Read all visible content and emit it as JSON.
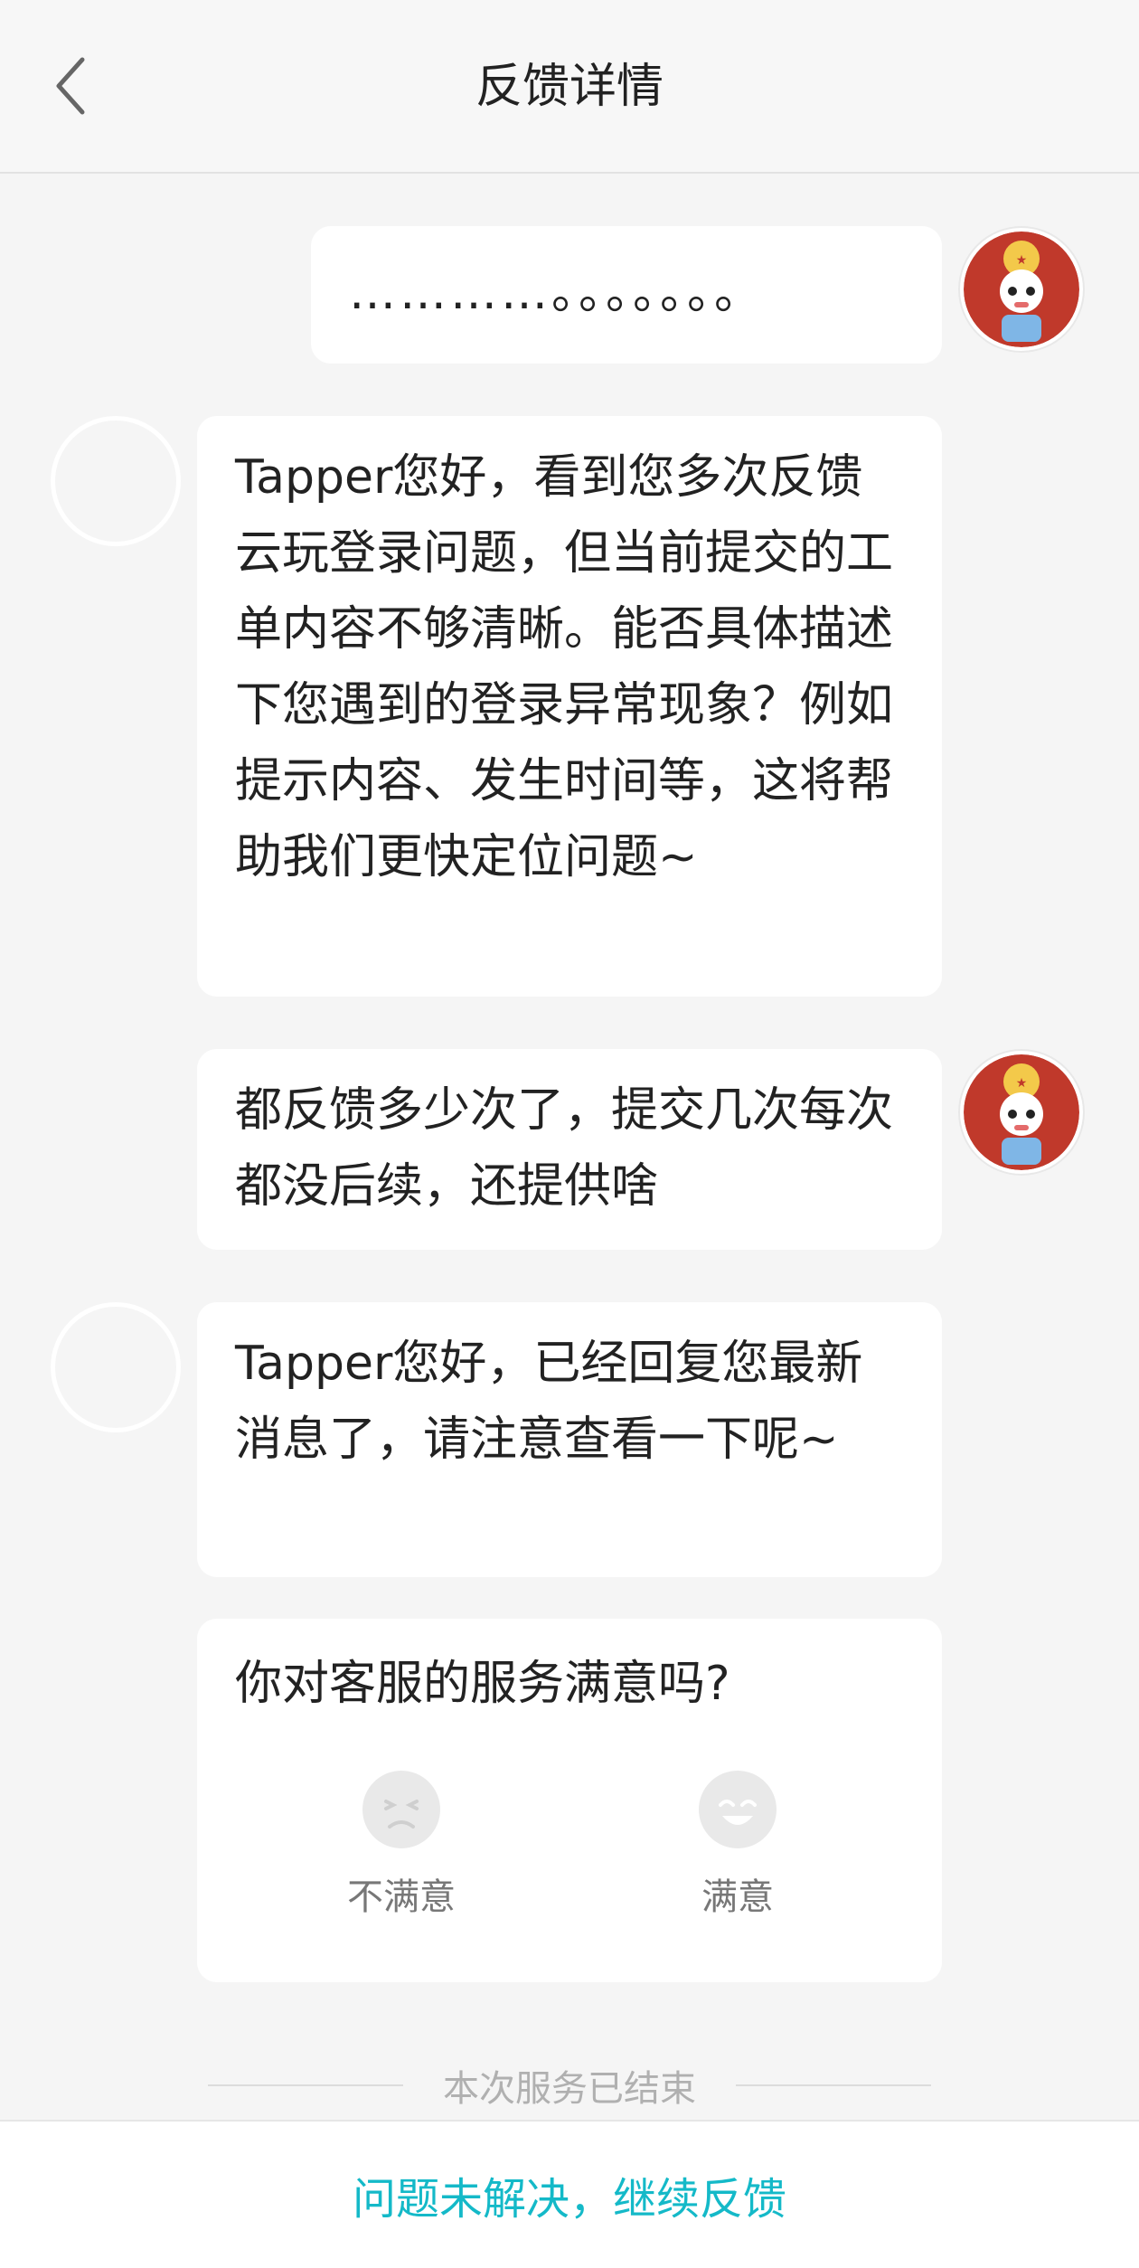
{
  "header": {
    "title": "反馈详情",
    "back_icon": "chevron-left-icon"
  },
  "messages": [
    {
      "sender": "user",
      "text": "…………。。。。。。。"
    },
    {
      "sender": "agent",
      "text": "Tapper您好，看到您多次反馈云玩登录问题，但当前提交的工单内容不够清晰。能否具体描述下您遇到的登录异常现象？例如提示内容、发生时间等，这将帮助我们更快定位问题~"
    },
    {
      "sender": "user",
      "text": "都反馈多少次了，提交几次每次都没后续，还提供啥"
    },
    {
      "sender": "agent",
      "text": "Tapper您好，已经回复您最新消息了，请注意查看一下呢~"
    }
  ],
  "rating": {
    "question": "你对客服的服务满意吗?",
    "options": [
      {
        "label": "不满意",
        "icon": "unsatisfied-face-icon"
      },
      {
        "label": "满意",
        "icon": "satisfied-face-icon"
      }
    ]
  },
  "end_notice": "本次服务已结束",
  "bottom": {
    "continue_label": "问题未解决，继续反馈"
  },
  "colors": {
    "accent": "#14b9c8",
    "background": "#f5f5f5",
    "bubble": "#ffffff"
  }
}
